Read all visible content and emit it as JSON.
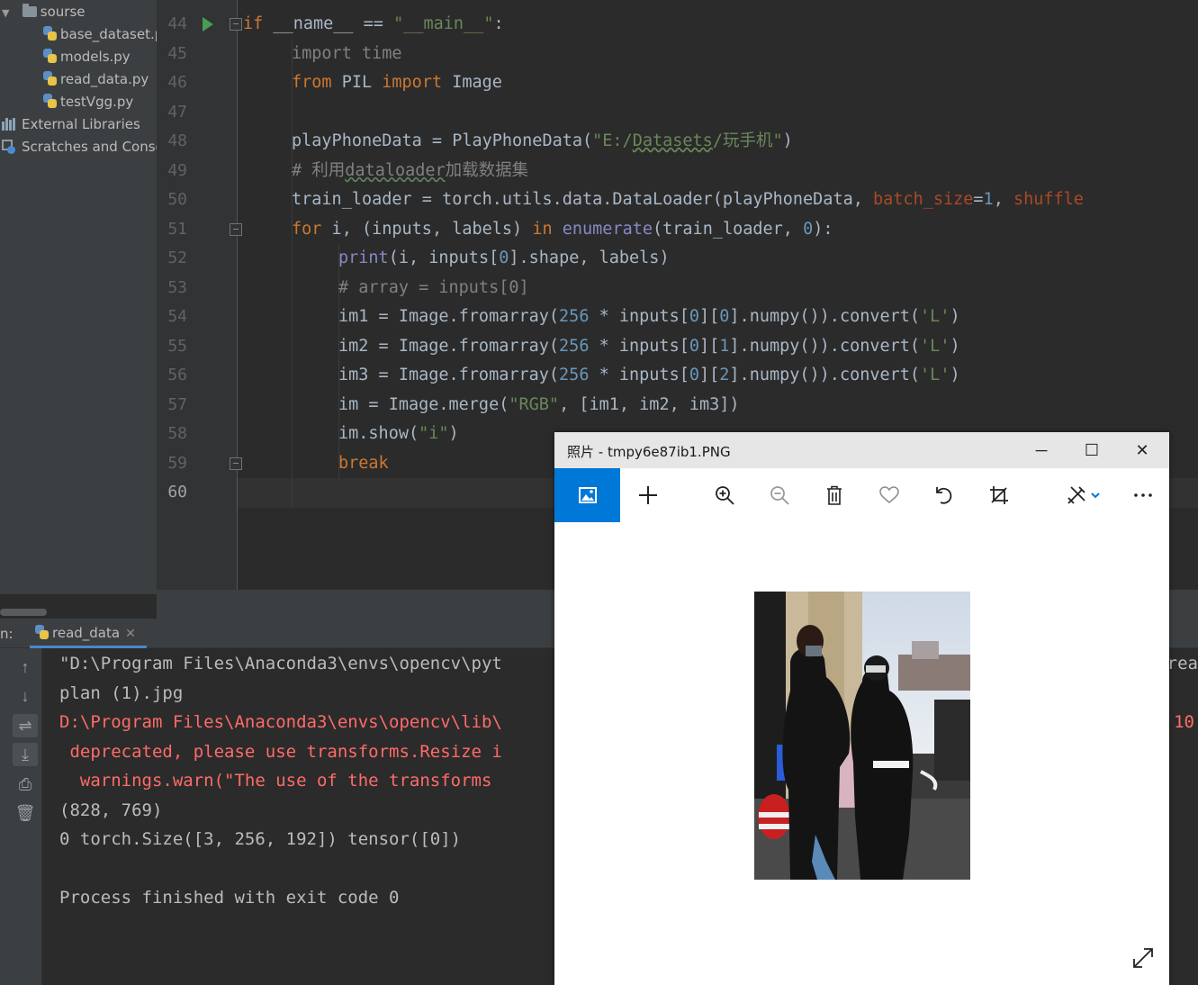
{
  "project_tree": {
    "items": [
      {
        "label": "sourse",
        "type": "folder"
      },
      {
        "label": "base_dataset.py",
        "type": "python"
      },
      {
        "label": "models.py",
        "type": "python"
      },
      {
        "label": "read_data.py",
        "type": "python"
      },
      {
        "label": "testVgg.py",
        "type": "python"
      },
      {
        "label": "External Libraries",
        "type": "libraries"
      },
      {
        "label": "Scratches and Consoles",
        "type": "scratches"
      }
    ]
  },
  "editor": {
    "line_numbers": [
      "44",
      "45",
      "46",
      "47",
      "48",
      "49",
      "50",
      "51",
      "52",
      "53",
      "54",
      "55",
      "56",
      "57",
      "58",
      "59",
      "60"
    ],
    "current_line": "60"
  },
  "run_panel": {
    "label": "n:",
    "tab_label": "read_data",
    "console_lines": [
      "\"D:\\Program Files\\Anaconda3\\envs\\opencv\\pyt",
      "plan (1).jpg",
      "D:\\Program Files\\Anaconda3\\envs\\opencv\\lib\\",
      " deprecated, please use transforms.Resize i",
      "  warnings.warn(\"The use of the transforms",
      "(828, 769)",
      "0 torch.Size([3, 256, 192]) tensor([0])",
      "",
      "Process finished with exit code 0"
    ],
    "right_fragments": [
      "rea",
      "10"
    ]
  },
  "photos_window": {
    "title": "照片 - tmpy6e87ib1.PNG",
    "toolbar": [
      "view-image",
      "add",
      "zoom-in",
      "zoom-out",
      "delete",
      "favorite",
      "rotate",
      "crop",
      "edit-create",
      "more"
    ]
  },
  "colors": {
    "editor_bg": "#2b2b2b",
    "keyword": "#cc7832",
    "string": "#6a8759",
    "number": "#6897bb",
    "comment": "#808080",
    "error": "#ff6b68",
    "photos_accent": "#0078d7"
  }
}
